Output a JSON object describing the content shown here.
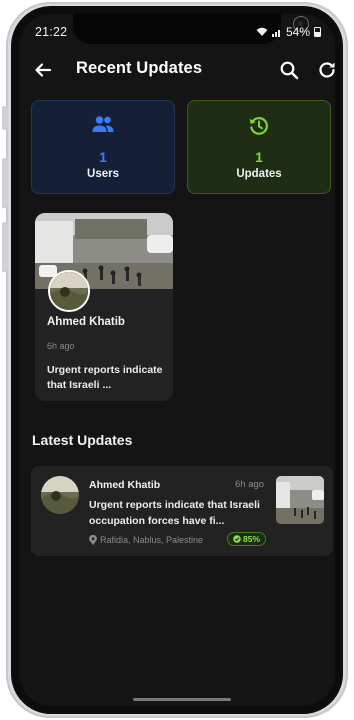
{
  "status_bar": {
    "time": "21:22",
    "battery": "54%",
    "icons": [
      "image-icon",
      "game-icon",
      "wifi-icon",
      "signal-icon",
      "battery-icon"
    ]
  },
  "app_bar": {
    "title": "Recent Updates",
    "icons": [
      "back-arrow-icon",
      "search-icon",
      "refresh-icon"
    ]
  },
  "stats": {
    "users": {
      "value": "1",
      "label": "Users",
      "icon": "users-icon",
      "color": "#3d7bf5"
    },
    "updates": {
      "value": "1",
      "label": "Updates",
      "icon": "history-icon",
      "color": "#7fd33b"
    }
  },
  "user_card": {
    "name": "Ahmed Khatib",
    "time": "6h ago",
    "text": "Urgent reports indicate that Israeli ..."
  },
  "latest_updates": {
    "title": "Latest Updates",
    "items": [
      {
        "author": "Ahmed Khatib",
        "time": "6h ago",
        "text": "Urgent reports indicate that Israeli occupation forces have fi...",
        "location": "Rafidia, Nablus, Palestine",
        "confidence": "85%"
      }
    ]
  },
  "colors": {
    "background": "#141414",
    "card": "#222222",
    "accent_blue": "#3d7bf5",
    "accent_green": "#7fd33b"
  }
}
